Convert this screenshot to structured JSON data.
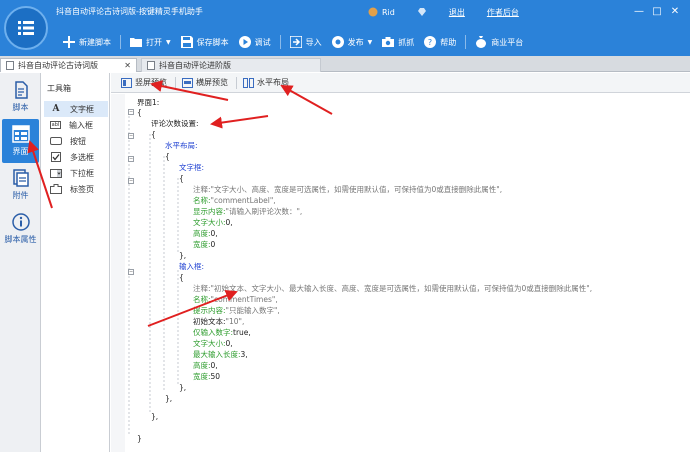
{
  "window": {
    "title": "抖音自动评论古诗词版-按键精灵手机助手",
    "top_links": {
      "user_name": "Rid",
      "logout": "退出",
      "author_backend": "作者后台"
    },
    "controls": {
      "minimize": "—",
      "maximize": "□",
      "close": "✕"
    }
  },
  "toolbar": {
    "new_script": "新建脚本",
    "open": "打开",
    "save_script": "保存脚本",
    "debug": "调试",
    "import": "导入",
    "publish": "发布",
    "capture": "抓抓",
    "help": "帮助",
    "business": "商业平台"
  },
  "doc_tabs": {
    "active": "抖音自动评论古诗词版",
    "inactive": "抖音自动评论进阶版",
    "close": "✕"
  },
  "sidebar": {
    "items": [
      {
        "label": "脚本",
        "icon": "document-icon"
      },
      {
        "label": "界面",
        "icon": "layout-grid-icon"
      },
      {
        "label": "附件",
        "icon": "attachment-icon"
      },
      {
        "label": "脚本属性",
        "icon": "info-icon"
      }
    ],
    "active_index": 1
  },
  "toolbox": {
    "title": "工具箱",
    "items": [
      {
        "label": "文字框",
        "icon": "A"
      },
      {
        "label": "输入框",
        "icon": "abl"
      },
      {
        "label": "按钮",
        "icon": "button"
      },
      {
        "label": "多选框",
        "icon": "checkbox"
      },
      {
        "label": "下拉框",
        "icon": "dropdown"
      },
      {
        "label": "标签页",
        "icon": "tab"
      }
    ],
    "selected_index": 0
  },
  "preview_tabs": {
    "portrait": "竖屏预览",
    "landscape": "横屏预览",
    "horizontal_layout": "水平布局"
  },
  "code": {
    "l_interface": "界面1:",
    "l_brace_open": "{",
    "l_brace_close": "}",
    "l_brace_close_comma": "},",
    "l_setting": "评论次数设置:",
    "l_hlayout": "水平布局:",
    "l_textbox": "文字框:",
    "l_inputbox": "输入框:",
    "tb_note_label": "注释:",
    "tb_note_value": "\"文字大小、高度、宽度是可选属性，如需使用默认值，可保持值为0或直接删除此属性\",",
    "tb_name_label": "名称:",
    "tb_name_value": "\"commentLabel\",",
    "tb_display_label": "显示内容:",
    "tb_display_value": "\"请输入刷评论次数：\",",
    "tb_fontsize_label": "文字大小:",
    "tb_fontsize_value": "0,",
    "tb_height_label": "高度:",
    "tb_height_value": "0,",
    "tb_width_label": "宽度:",
    "tb_width_value": "0",
    "ib_note_label": "注释:",
    "ib_note_value": "\"初始文本、文字大小、最大输入长度、高度、宽度是可选属性，如需使用默认值，可保持值为0或直接删除此属性\",",
    "ib_name_label": "名称:",
    "ib_name_value": "\"commentTimes\",",
    "ib_hint_label": "提示内容:",
    "ib_hint_value": "\"只能输入数字\",",
    "ib_init_label": "初始文本:",
    "ib_init_value": "\"10\",",
    "ib_digits_label": "仅输入数字:",
    "ib_digits_value": "true,",
    "ib_fontsize_label": "文字大小:",
    "ib_fontsize_value": "0,",
    "ib_maxlen_label": "最大输入长度:",
    "ib_maxlen_value": "3,",
    "ib_height_label": "高度:",
    "ib_height_value": "0,",
    "ib_width_label": "宽度:",
    "ib_width_value": "50"
  },
  "colors": {
    "header_blue": "#2b82d9",
    "annotation_red": "#e02020",
    "code_blue": "#1d3fd1",
    "code_green": "#2e9d2e"
  }
}
